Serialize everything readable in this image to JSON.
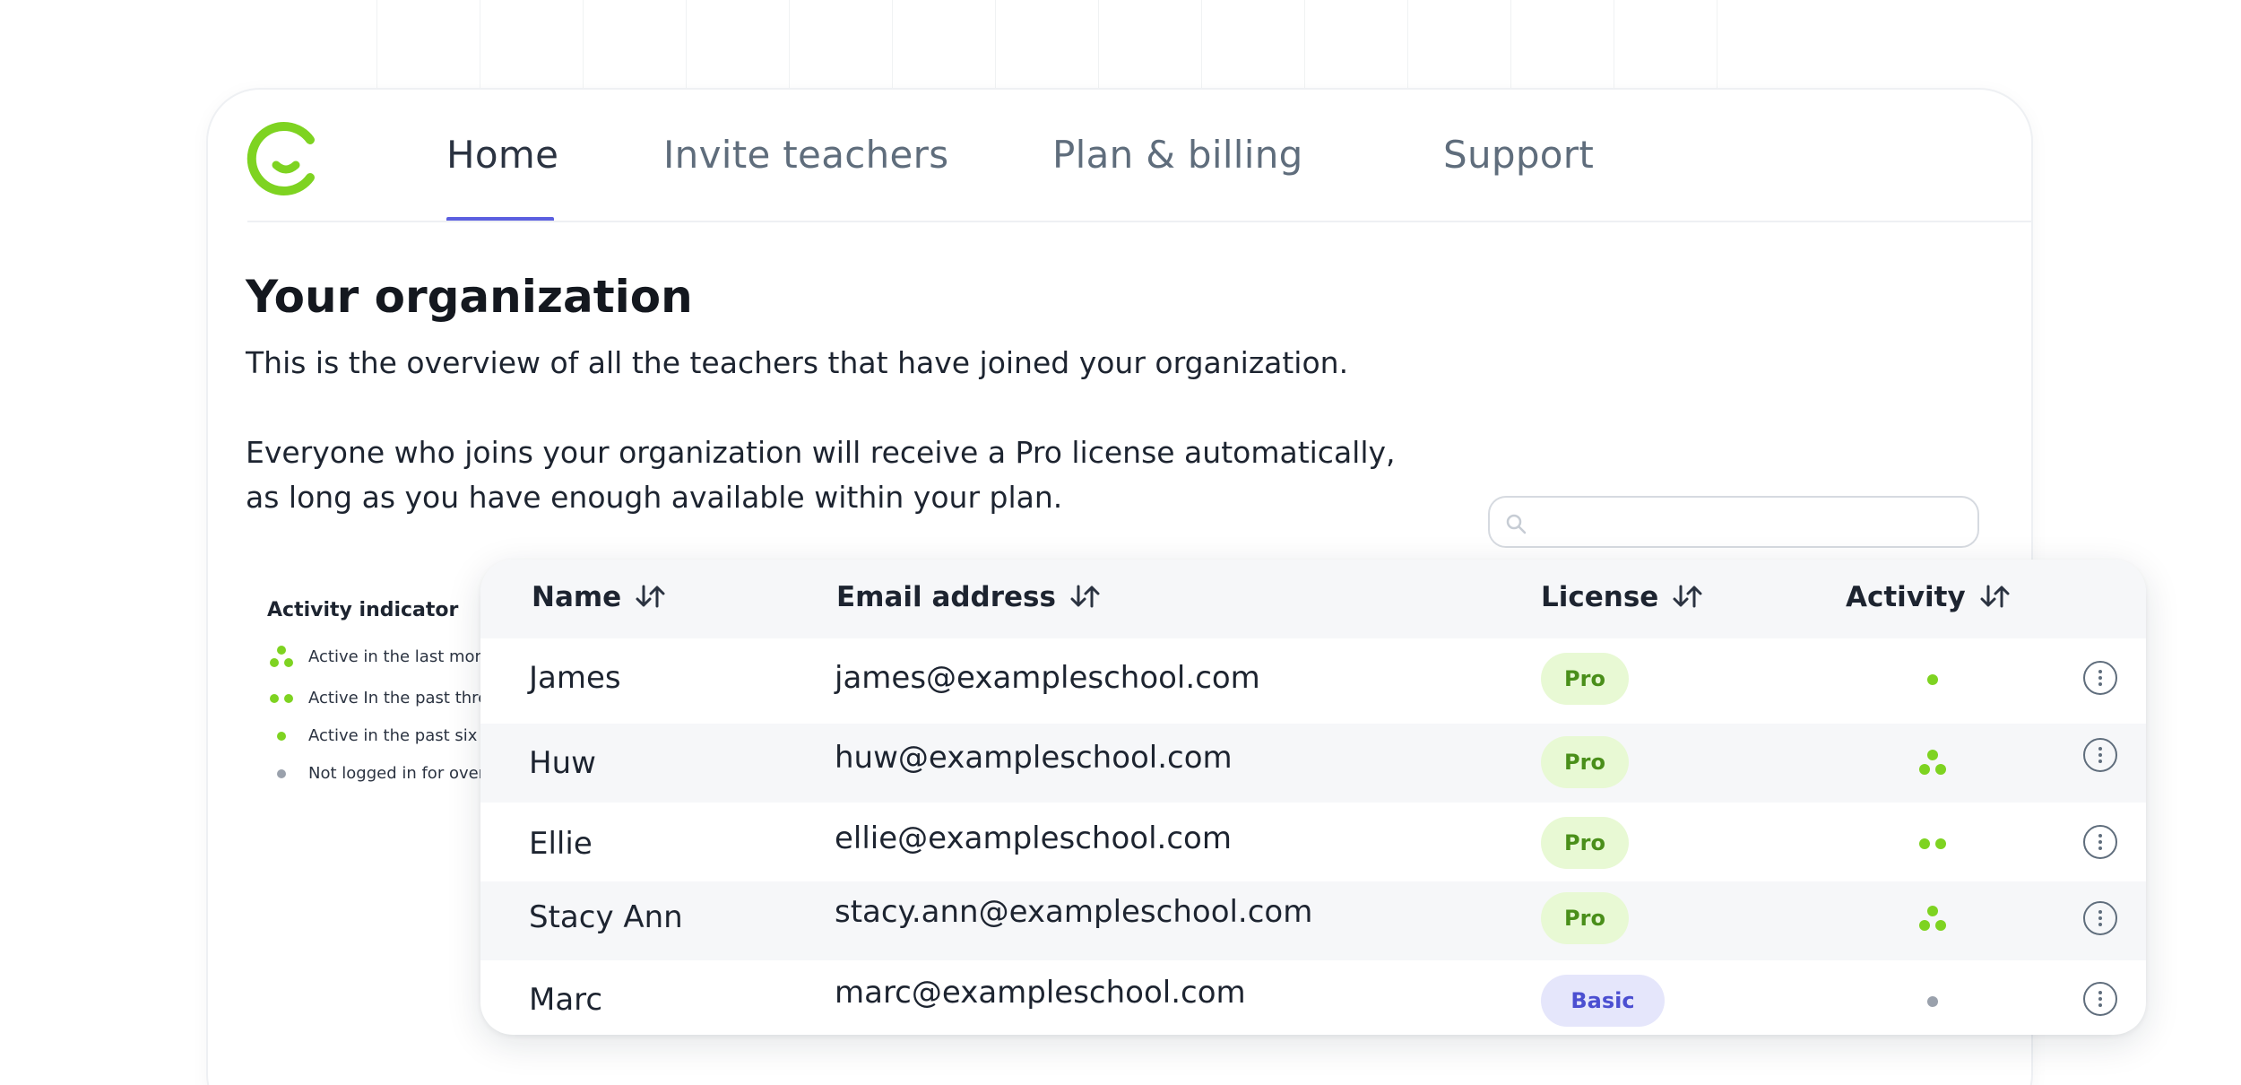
{
  "nav": {
    "tabs": [
      {
        "label": "Home",
        "active": true
      },
      {
        "label": "Invite teachers",
        "active": false
      },
      {
        "label": "Plan & billing",
        "active": false
      },
      {
        "label": "Support",
        "active": false
      }
    ],
    "logo_icon": "smile-c-logo-icon"
  },
  "page": {
    "title": "Your organization",
    "intro": "This is the overview of all the teachers that have joined your organization.",
    "license_note": "Everyone who joins your organization will receive a Pro license automatically, as long as you have enough available within your plan."
  },
  "search": {
    "placeholder": "",
    "icon": "search-icon"
  },
  "legend": {
    "title": "Activity indicator",
    "items": [
      {
        "label": "Active in the last month",
        "level": "three-dots"
      },
      {
        "label": "Active In the past three months",
        "level": "two-dots"
      },
      {
        "label": "Active in the past six months",
        "level": "one-dot"
      },
      {
        "label": "Not logged in for over six months",
        "level": "inactive"
      }
    ]
  },
  "table": {
    "columns": [
      "Name",
      "Email address",
      "License",
      "Activity"
    ],
    "rows": [
      {
        "name": "James",
        "email": "james@exampleschool.com",
        "license": "Pro",
        "activity": "one-dot"
      },
      {
        "name": "Huw",
        "email": "huw@exampleschool.com",
        "license": "Pro",
        "activity": "three-dots"
      },
      {
        "name": "Ellie",
        "email": "ellie@exampleschool.com",
        "license": "Pro",
        "activity": "two-dots"
      },
      {
        "name": "Stacy Ann",
        "email": "stacy.ann@exampleschool.com",
        "license": "Pro",
        "activity": "three-dots"
      },
      {
        "name": "Marc",
        "email": "marc@exampleschool.com",
        "license": "Basic",
        "activity": "inactive"
      }
    ]
  },
  "colors": {
    "brand_green": "#7ed321",
    "accent_indigo": "#5b5fe0",
    "inactive_grey": "#9aa1ac",
    "pro_badge_bg": "#e8f9d4",
    "basic_badge_bg": "#e5e6fb"
  }
}
